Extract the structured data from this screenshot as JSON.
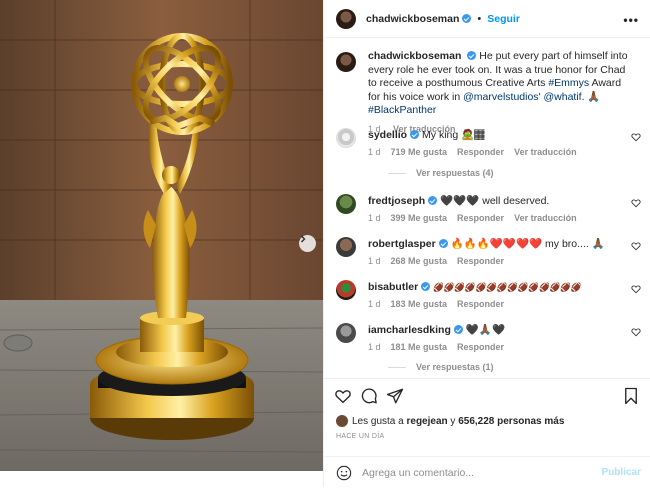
{
  "post": {
    "author": "chadwickboseman",
    "follow_label": "Seguir",
    "more_label": "•••",
    "caption_prefix": "He put every part of himself into every role he ever took on. It was a true honor for Chad to receive a posthumous Creative Arts ",
    "caption_tag1": "#Emmys",
    "caption_mid": " Award for his voice work in ",
    "caption_mention1": "@marvelstudios",
    "caption_apos": "' ",
    "caption_mention2": "@whatif",
    "caption_emoji": ". 🙏🏾 ",
    "caption_tag2": "#BlackPanther",
    "caption_time": "1 d",
    "caption_translate": "Ver traducción"
  },
  "comments": [
    {
      "user": "sydellio",
      "verified": true,
      "text": "My king 🧟🏾",
      "time": "1 d",
      "likes": "719 Me gusta",
      "reply": "Responder",
      "translate": "Ver traducción",
      "replies": "Ver respuestas (4)"
    },
    {
      "user": "fredtjoseph",
      "verified": true,
      "text": "🖤🖤🖤 well deserved.",
      "time": "1 d",
      "likes": "399 Me gusta",
      "reply": "Responder",
      "translate": "Ver traducción"
    },
    {
      "user": "robertglasper",
      "verified": true,
      "text": "🔥🔥🔥❤️❤️❤️❤️ my bro.... 🙏🏾",
      "time": "1 d",
      "likes": "268 Me gusta",
      "reply": "Responder"
    },
    {
      "user": "bisabutler",
      "verified": true,
      "text": "🏈🏈🏈🏈🏈🏈🏈🏈🏈🏈🏈🏈🏈🏈",
      "time": "1 d",
      "likes": "183 Me gusta",
      "reply": "Responder"
    },
    {
      "user": "iamcharlesdking",
      "verified": true,
      "text": "🖤🙏🏾🖤",
      "time": "1 d",
      "likes": "181 Me gusta",
      "reply": "Responder",
      "replies": "Ver respuestas (1)"
    }
  ],
  "likes_bar": {
    "prefix": "Les gusta a",
    "user": "regejean",
    "joiner": "y",
    "count": "656,228 personas más",
    "ago": "HACE UN DÍA"
  },
  "add_comment": {
    "placeholder": "Agrega un comentario...",
    "publish": "Publicar"
  },
  "icons": [
    "heart-icon",
    "comment-icon",
    "share-icon",
    "bookmark-icon",
    "emoji-icon",
    "next-arrow-icon",
    "more-options-icon"
  ],
  "colors": {
    "accent": "#0095f6",
    "link": "#00376b",
    "muted": "#8e8e8e",
    "verified": "#3897f0"
  }
}
